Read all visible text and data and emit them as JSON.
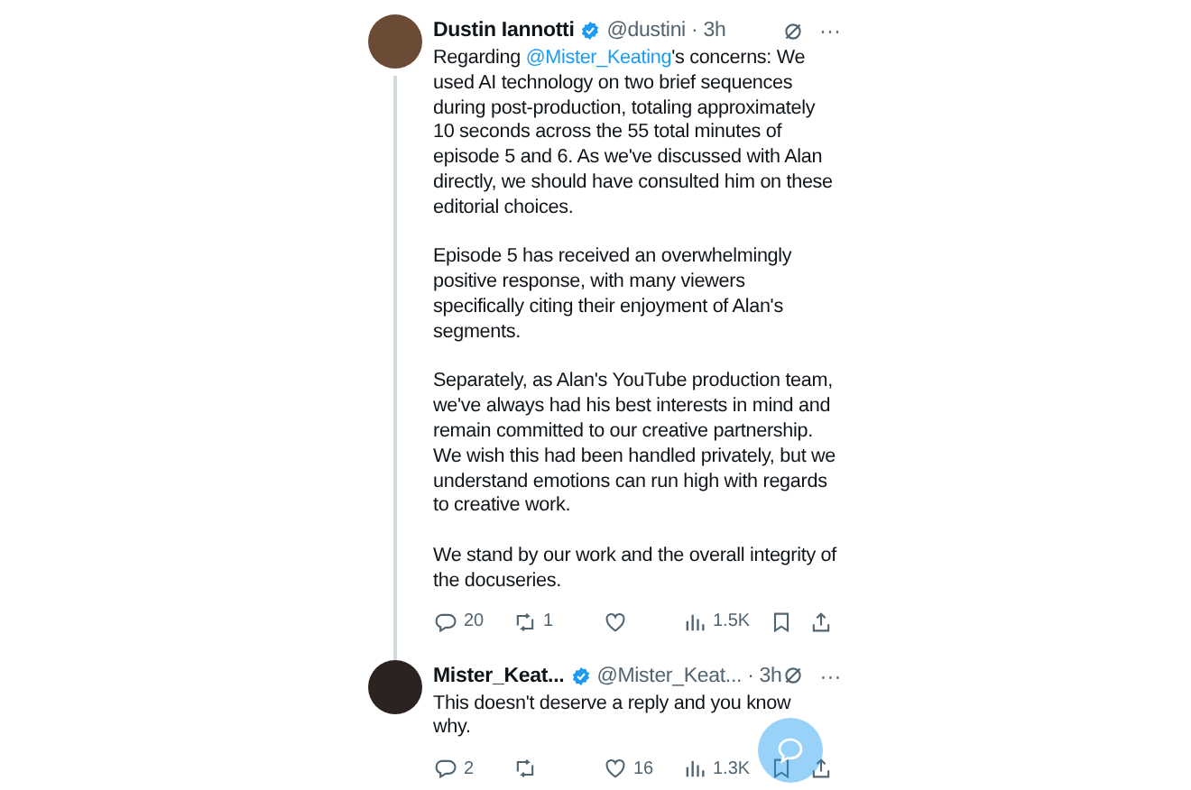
{
  "tweets": [
    {
      "author": "Dustin Iannotti",
      "verified": true,
      "handle": "@dustini",
      "time": "· 3h",
      "menu": "···",
      "thread_line": true,
      "paragraphs": [
        [
          {
            "kind": "text",
            "text": "Regarding "
          },
          {
            "kind": "mention",
            "text": "@Mister_Keating"
          },
          {
            "kind": "text",
            "text": "'s concerns: We used AI technology on two brief sequences during post-production, totaling approximately 10 seconds across the 55 total minutes of episode 5 and 6. As we've discussed with Alan directly, we should have consulted him on these editorial choices."
          }
        ],
        [
          {
            "kind": "text",
            "text": "Episode 5 has received an overwhelmingly positive response, with many viewers specifically citing their enjoyment of Alan's segments."
          }
        ],
        [
          {
            "kind": "text",
            "text": "Separately, as Alan's YouTube production team, we've always had his best interests in mind and remain committed to our creative partnership. We wish this had been handled privately, but we understand emotions can run high with regards to creative work."
          }
        ],
        [
          {
            "kind": "text",
            "text": "We stand by our work and the overall integrity of the docuseries."
          }
        ]
      ],
      "actions": [
        {
          "kind": "reply",
          "count": "20"
        },
        {
          "kind": "repost",
          "count": "1"
        },
        {
          "kind": "like"
        },
        {
          "kind": "views",
          "count": "1.5K"
        },
        {
          "kind": "bookmark"
        },
        {
          "kind": "share"
        }
      ]
    },
    {
      "author": "Mister_Keat...",
      "verified": true,
      "handle": "@Mister_Keat...",
      "time": "· 3h",
      "menu": "···",
      "thread_line": false,
      "paragraphs": [
        [
          {
            "kind": "text",
            "text": "This doesn't deserve a reply and you know why."
          }
        ]
      ],
      "actions": [
        {
          "kind": "reply",
          "count": "2"
        },
        {
          "kind": "repost"
        },
        {
          "kind": "like",
          "count": "16"
        },
        {
          "kind": "views",
          "count": "1.3K"
        },
        {
          "kind": "bookmark"
        },
        {
          "kind": "share"
        }
      ]
    }
  ]
}
